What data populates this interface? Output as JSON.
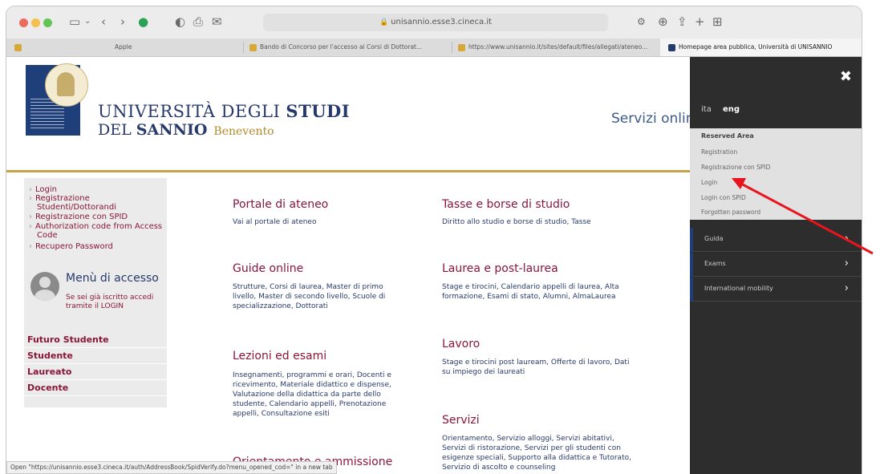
{
  "browser": {
    "address": "unisannio.esse3.cineca.it",
    "tabs": [
      {
        "label": "Apple"
      },
      {
        "label": "Bando di Concorso per l'accesso ai Corsi di Dottorat..."
      },
      {
        "label": "https://www.unisannio.it/sites/default/files/allegati/ateneo..."
      },
      {
        "label": "Homepage area pubblica, Università di UNISANNIO"
      }
    ],
    "status_text": "Open \"https://unisannio.esse3.cineca.it/auth/AddressBook/SpidVerify.do?menu_opened_cod=\" in a new tab"
  },
  "header": {
    "uni_line1_a": "UNIVERSITÀ ",
    "uni_line1_b": "DEGLI ",
    "uni_line1_c": "STUDI",
    "uni_line2_a": "DEL ",
    "uni_line2_b": "SANNIO",
    "uni_line2_city": "Benevento",
    "servizi": "Servizi online"
  },
  "sidebar": {
    "links": [
      {
        "label": "Login"
      },
      {
        "label": "Registrazione Studenti/Dottorandi"
      },
      {
        "label": "Registrazione con SPID"
      },
      {
        "label": "Authorization code from Access Code"
      },
      {
        "label": "Recupero Password"
      }
    ],
    "menu_title": "Menù di accesso",
    "menu_desc": "Se sei già iscritto accedi tramite il LOGIN",
    "categories": [
      {
        "label": "Futuro Studente"
      },
      {
        "label": "Studente"
      },
      {
        "label": "Laureato"
      },
      {
        "label": "Docente"
      }
    ]
  },
  "main": {
    "sections": [
      {
        "title": "Portale di ateneo",
        "text": "Vai al portale di ateneo"
      },
      {
        "title": "Tasse e borse di studio",
        "text": "Diritto allo studio e borse di studio, Tasse"
      },
      {
        "title": "Guide online",
        "text": "Strutture, Corsi di laurea, Master di primo livello, Master di secondo livello, Scuole di specializzazione, Dottorati"
      },
      {
        "title": "Laurea e post-laurea",
        "text": "Stage e tirocini, Calendario appelli di laurea, Alta formazione, Esami di stato, Alumni, AlmaLaurea"
      },
      {
        "title": "Lavoro",
        "text": "Stage e tirocini post lauream, Offerte di lavoro, Dati su impiego dei laureati"
      },
      {
        "title": "Lezioni ed esami",
        "text": "Insegnamenti, programmi e orari, Docenti e ricevimento, Materiale didattico e dispense, Valutazione della didattica da parte dello studente, Calendario appelli, Prenotazione appelli, Consultazione esiti"
      },
      {
        "title": "Servizi",
        "text": "Orientamento, Servizio alloggi, Servizi abitativi, Servizi di ristorazione, Servizi per gli studenti con esigenze speciali, Supporto alla didattica e Tutorato, Servizio di ascolto e counseling"
      },
      {
        "title": "Orientamento e ammissione",
        "text": ""
      }
    ]
  },
  "panel": {
    "lang_ita": "ita",
    "lang_eng": "eng",
    "reserved_header": "Reserved Area",
    "reserved_items": [
      {
        "label": "Registration"
      },
      {
        "label": "Registrazione con SPID"
      },
      {
        "label": "Login"
      },
      {
        "label": "Login con SPID"
      },
      {
        "label": "Forgotten password"
      }
    ],
    "menu_items": [
      {
        "label": "Guida"
      },
      {
        "label": "Exams"
      },
      {
        "label": "International mobility"
      }
    ]
  },
  "annotation": {
    "arrow_color": "#e8141e"
  }
}
